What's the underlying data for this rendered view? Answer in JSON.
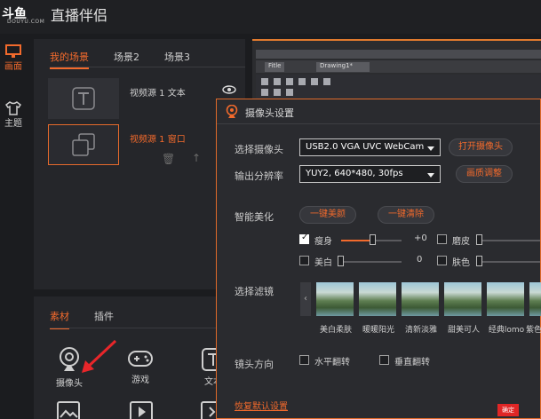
{
  "app": {
    "brand": "斗鱼",
    "brand_sub": "DOUYU.COM",
    "title": "直播伴侣"
  },
  "rail": {
    "items": [
      {
        "label": "画面"
      },
      {
        "label": "主题"
      }
    ]
  },
  "scenes": {
    "tabs": [
      "我的场景",
      "场景2",
      "场景3"
    ],
    "active_tab": 0,
    "sources": [
      {
        "label": "视频源 1 文本",
        "selected": false
      },
      {
        "label": "视频源 1 窗口",
        "selected": true
      }
    ]
  },
  "preview": {
    "tabs": [
      "Fitle",
      "Drawing1*"
    ]
  },
  "material": {
    "tabs": [
      "素材",
      "插件"
    ],
    "items": [
      {
        "label": "摄像头"
      },
      {
        "label": "游戏"
      },
      {
        "label": "文本"
      }
    ]
  },
  "dialog": {
    "title": "摄像头设置",
    "camera_label": "选择摄像头",
    "camera_value": "USB2.0 VGA UVC WebCam",
    "open_camera": "打开摄像头",
    "resolution_label": "输出分辨率",
    "resolution_value": "YUY2,  640*480,  30fps",
    "quality_adjust": "画质调整",
    "beauty_label": "智能美化",
    "one_key_beauty": "一键美颜",
    "one_key_clear": "一键清除",
    "options": [
      {
        "label": "瘦身",
        "checked": true,
        "value": "+0",
        "level": 0.5
      },
      {
        "label": "磨皮",
        "checked": false,
        "level": 0
      },
      {
        "label": "美白",
        "checked": false,
        "value": "0",
        "level": 0
      },
      {
        "label": "肤色",
        "checked": false,
        "level": 0
      }
    ],
    "filter_label": "选择滤镜",
    "filters": [
      "美白柔肤",
      "暖暖阳光",
      "清新淡雅",
      "甜美可人",
      "经典lomo",
      "紫色"
    ],
    "direction_label": "镜头方向",
    "flip_h": "水平翻转",
    "flip_v": "垂直翻转",
    "reset": "恢复默认设置",
    "hot_badge": "确定"
  },
  "colors": {
    "accent": "#f26a2c"
  }
}
